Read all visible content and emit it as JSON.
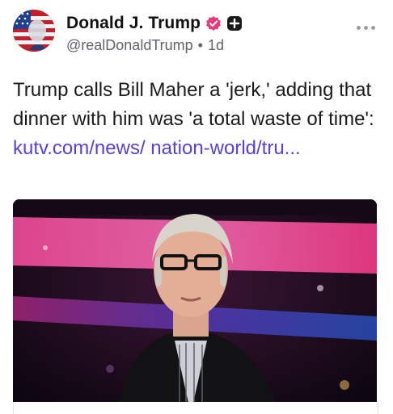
{
  "post": {
    "display_name": "Donald J. Trump",
    "handle": "@realDonaldTrump",
    "separator": "•",
    "time_ago": "1d",
    "text": "Trump calls Bill Maher a 'jerk,' adding that dinner with him was 'a total waste of time': ",
    "link_text": "kutv.com/news/ nation-world/tru..."
  },
  "icons": {
    "verified": "verified-badge-icon",
    "plus": "plus-badge-icon",
    "more": "more-options-icon"
  },
  "colors": {
    "link": "#5b3fd6",
    "verified": "#e63a7a",
    "handle": "#5f6368"
  }
}
